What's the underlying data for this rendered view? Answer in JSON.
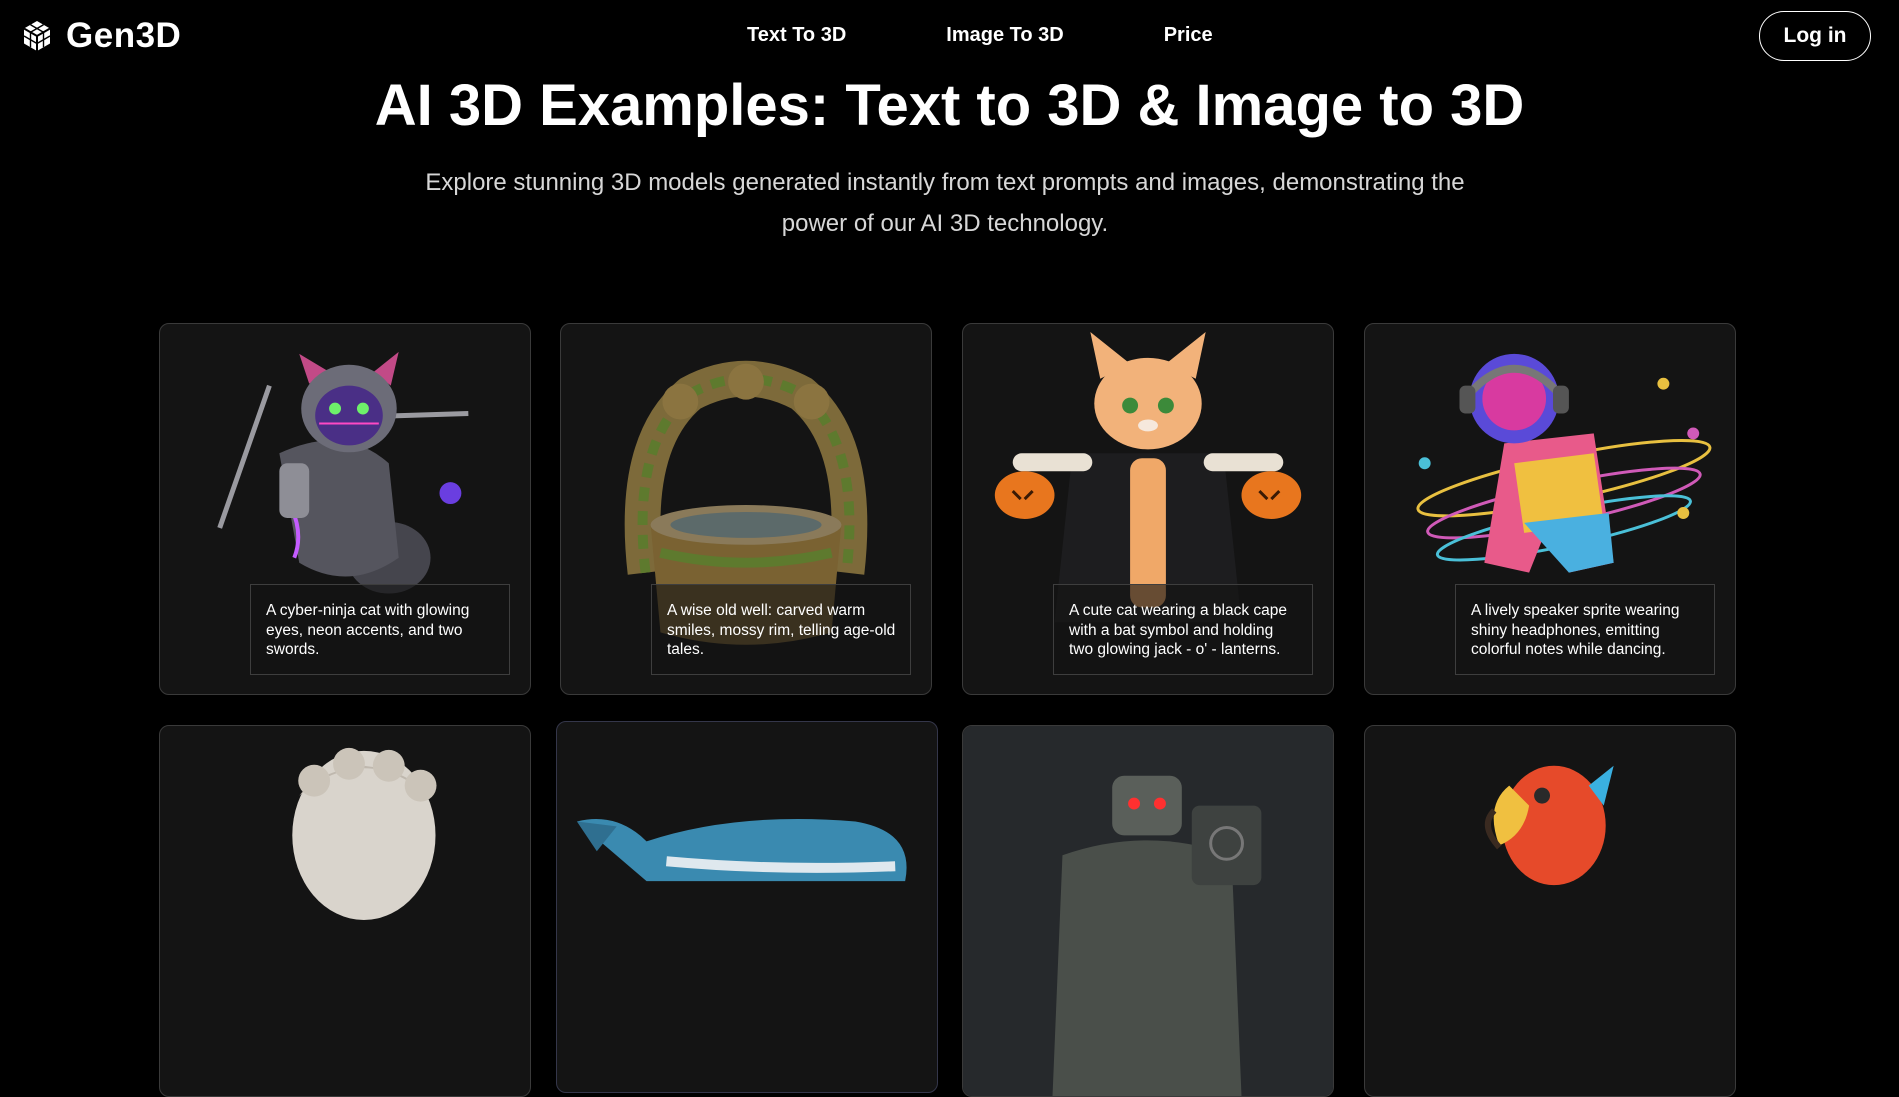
{
  "nav": {
    "logo_text": "Gen3D",
    "links": [
      "Text To 3D",
      "Image To 3D",
      "Price"
    ],
    "login_label": "Log in"
  },
  "hero": {
    "title": "AI 3D Examples: Text to 3D & Image to 3D",
    "subtitle": "Explore stunning 3D models generated instantly from text prompts and images, demonstrating the power of our AI 3D technology."
  },
  "examples": [
    {
      "image": "cyber-ninja-cat",
      "caption": "A cyber-ninja cat with glowing eyes, neon accents, and two swords."
    },
    {
      "image": "old-wishing-well",
      "caption": "A wise old well: carved warm smiles, mossy rim, telling age-old tales."
    },
    {
      "image": "cat-in-cape-with-pumpkins",
      "caption": "A cute cat wearing a black cape with a bat symbol and holding two glowing jack - o' - lanterns."
    },
    {
      "image": "dancing-speaker-sprite",
      "caption": "A lively speaker sprite wearing shiny headphones, emitting colorful notes while dancing."
    },
    {
      "image": "marble-bust"
    },
    {
      "image": "blue-whale"
    },
    {
      "image": "stone-golem-warrior"
    },
    {
      "image": "cartoon-parrot"
    }
  ],
  "colors": {
    "background": "#000000",
    "card_background": "#141414",
    "card_border": "#3a3a3a",
    "text": "#ffffff",
    "subtitle": "#d7d7d7"
  }
}
